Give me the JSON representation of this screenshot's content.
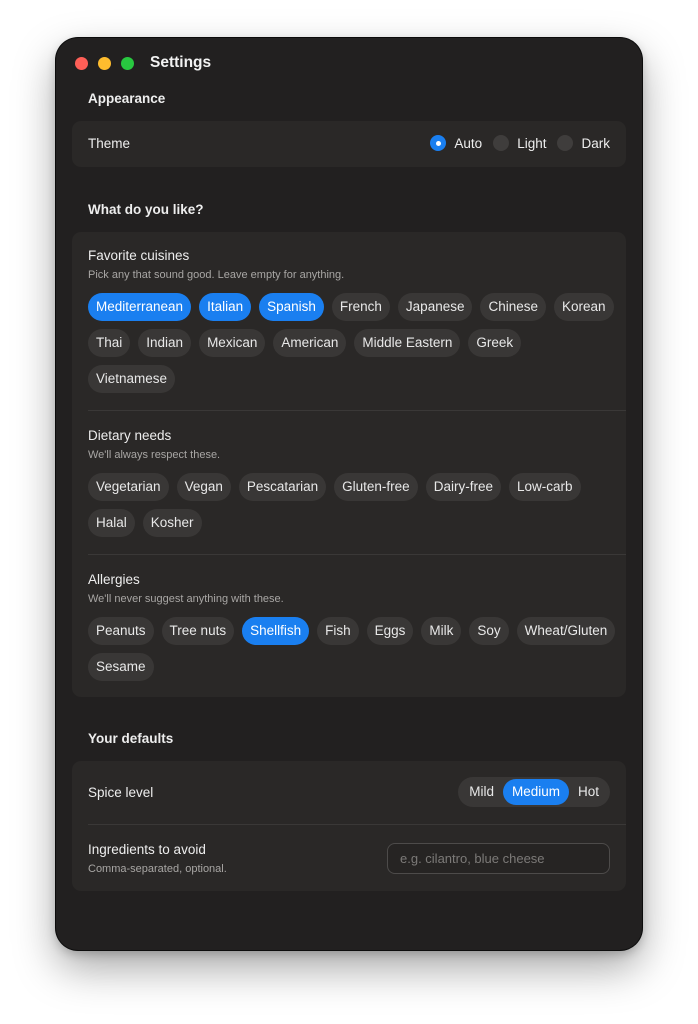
{
  "window": {
    "title": "Settings"
  },
  "appearance": {
    "section_title": "Appearance",
    "theme_label": "Theme",
    "theme_options": [
      "Auto",
      "Light",
      "Dark"
    ],
    "theme_selected": "Auto"
  },
  "likes": {
    "section_title": "What do you like?",
    "cuisines": {
      "label": "Favorite cuisines",
      "description": "Pick any that sound good. Leave empty for anything.",
      "options": [
        "Mediterranean",
        "Italian",
        "Spanish",
        "French",
        "Japanese",
        "Chinese",
        "Korean",
        "Thai",
        "Indian",
        "Mexican",
        "American",
        "Middle Eastern",
        "Greek",
        "Vietnamese"
      ],
      "selected": [
        "Mediterranean",
        "Italian",
        "Spanish"
      ]
    },
    "dietary": {
      "label": "Dietary needs",
      "description": "We'll always respect these.",
      "options": [
        "Vegetarian",
        "Vegan",
        "Pescatarian",
        "Gluten-free",
        "Dairy-free",
        "Low-carb",
        "Halal",
        "Kosher"
      ],
      "selected": []
    },
    "allergies": {
      "label": "Allergies",
      "description": "We'll never suggest anything with these.",
      "options": [
        "Peanuts",
        "Tree nuts",
        "Shellfish",
        "Fish",
        "Eggs",
        "Milk",
        "Soy",
        "Wheat/Gluten",
        "Sesame"
      ],
      "selected": [
        "Shellfish"
      ]
    }
  },
  "defaults": {
    "section_title": "Your defaults",
    "spice": {
      "label": "Spice level",
      "options": [
        "Mild",
        "Medium",
        "Hot"
      ],
      "selected": "Medium"
    },
    "avoid": {
      "label": "Ingredients to avoid",
      "description": "Comma-separated, optional.",
      "value": "",
      "placeholder": "e.g. cilantro, blue cheese"
    }
  },
  "colors": {
    "accent": "#1a7ff0",
    "window_bg": "#222020",
    "card_bg": "#2a2827",
    "chip_bg": "#393736"
  }
}
